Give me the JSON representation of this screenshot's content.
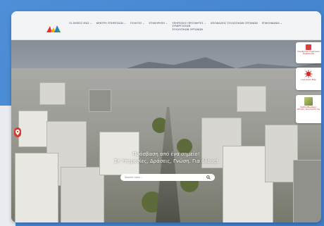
{
  "header": {
    "logo_icon": "site-logo-icon",
    "nav": [
      {
        "label": "ΟΙ ΔΗΜΟΣ ΜΑΣ",
        "has_dropdown": true
      },
      {
        "label": "ΚΕΝΤΡΟ ΥΠΗΡΕΣΙΩΝ",
        "has_dropdown": true
      },
      {
        "label": "ΠΟΛΙΤΕΣ",
        "has_dropdown": true
      },
      {
        "label": "ΕΠΙΧΕΙΡΗΣΗ",
        "has_dropdown": true
      },
      {
        "label_lines": [
          "ΥΠΗΡΕΣΙΕΣ ΠΡΟΣΦΥΓΕΣ",
          "ΣΥΝΕΡΓΑΣΙΩΝ",
          "ΣΥΛΛΟΓΙΚΩΝ ΟΡΓΑΝΩΝ"
        ],
        "has_dropdown": true
      },
      {
        "label": "ΑΠΟΦΑΣΕΙΣ ΣΥΛΛΟΓΙΚΩΝ ΟΡΓΑΝΩΝ",
        "has_dropdown": false
      },
      {
        "label": "ΕΠΙΚΟΙΝΩΝΙΑ",
        "has_dropdown": true
      }
    ]
  },
  "hero": {
    "line1": "Πρόσβαση από ένα σημείο!",
    "line2": "Σε Υπηρεσίες, Δράσεις, Γνώση. Για όλους!",
    "search_placeholder": "Search here..."
  },
  "widgets": [
    {
      "label": "Συνεδρίαση δημοτικού Συμβουλίου",
      "icon": "council-icon"
    },
    {
      "label": "Live Covid Map",
      "icon": "covid-virus-icon"
    },
    {
      "label": "Σχέδιο Βιώσιμης Αστικής Κινητικότητας",
      "icon": "map-thumbnail-icon"
    }
  ],
  "colors": {
    "accent": "#d63a2e",
    "nav_text": "#3a4763",
    "widget_text": "#b01e1e",
    "outer_bg": "#4a8ad4"
  }
}
